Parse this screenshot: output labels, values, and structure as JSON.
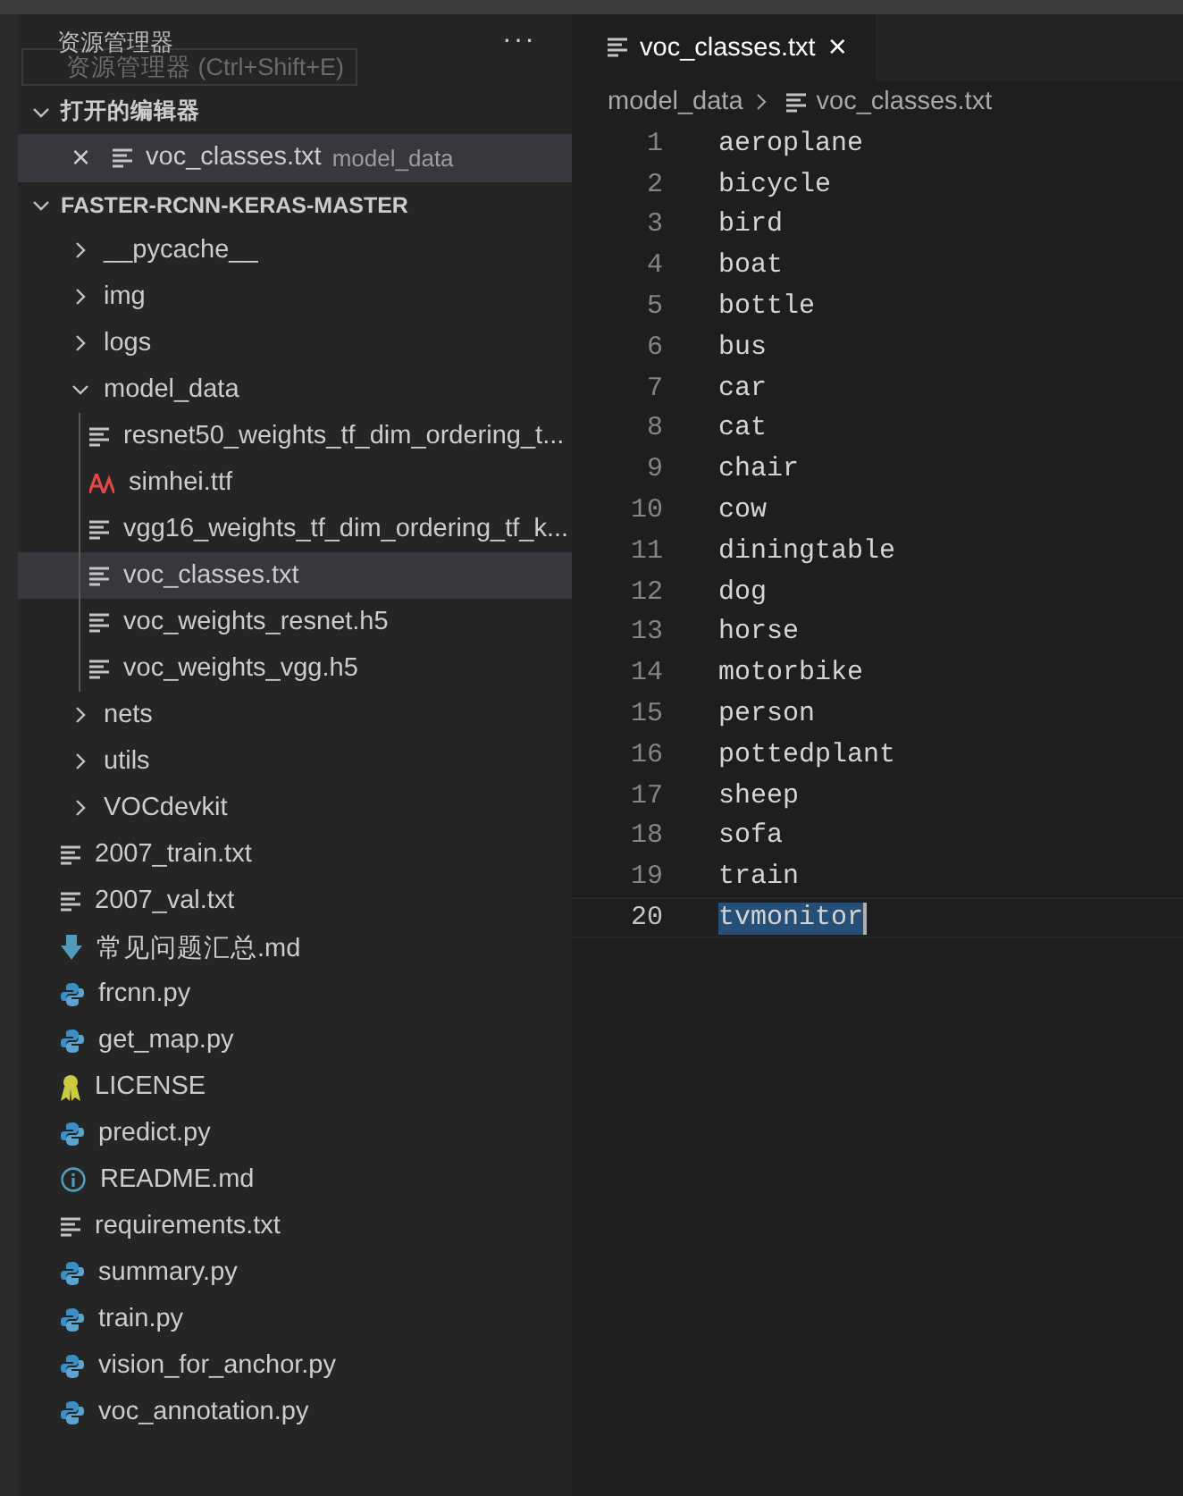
{
  "sidebar": {
    "title": "资源管理器",
    "more": "···",
    "tooltip": "资源管理器 (Ctrl+Shift+E)",
    "open_editors": {
      "title": "打开的编辑器",
      "expanded": true,
      "items": [
        {
          "close": "×",
          "name": "voc_classes.txt",
          "folder": "model_data",
          "kind": "text",
          "selected": true
        }
      ]
    },
    "project": {
      "title": "FASTER-RCNN-KERAS-MASTER",
      "expanded": true,
      "items": [
        {
          "name": "__pycache__",
          "kind": "folder",
          "expanded": false,
          "selected": false
        },
        {
          "name": "img",
          "kind": "folder",
          "expanded": false,
          "selected": false
        },
        {
          "name": "logs",
          "kind": "folder",
          "expanded": false,
          "selected": false
        },
        {
          "name": "model_data",
          "kind": "folder",
          "expanded": true,
          "selected": false,
          "children": [
            {
              "name": "resnet50_weights_tf_dim_ordering_t...",
              "kind": "text",
              "selected": false
            },
            {
              "name": "simhei.ttf",
              "kind": "font",
              "selected": false
            },
            {
              "name": "vgg16_weights_tf_dim_ordering_tf_k...",
              "kind": "text",
              "selected": false
            },
            {
              "name": "voc_classes.txt",
              "kind": "text",
              "selected": true
            },
            {
              "name": "voc_weights_resnet.h5",
              "kind": "text",
              "selected": false
            },
            {
              "name": "voc_weights_vgg.h5",
              "kind": "text",
              "selected": false
            }
          ]
        },
        {
          "name": "nets",
          "kind": "folder",
          "expanded": false,
          "selected": false
        },
        {
          "name": "utils",
          "kind": "folder",
          "expanded": false,
          "selected": false
        },
        {
          "name": "VOCdevkit",
          "kind": "folder",
          "expanded": false,
          "selected": false
        },
        {
          "name": "2007_train.txt",
          "kind": "text",
          "selected": false
        },
        {
          "name": "2007_val.txt",
          "kind": "text",
          "selected": false
        },
        {
          "name": "常见问题汇总.md",
          "kind": "download",
          "selected": false
        },
        {
          "name": "frcnn.py",
          "kind": "python",
          "selected": false
        },
        {
          "name": "get_map.py",
          "kind": "python",
          "selected": false
        },
        {
          "name": "LICENSE",
          "kind": "license",
          "selected": false
        },
        {
          "name": "predict.py",
          "kind": "python",
          "selected": false
        },
        {
          "name": "README.md",
          "kind": "info",
          "selected": false
        },
        {
          "name": "requirements.txt",
          "kind": "text",
          "selected": false
        },
        {
          "name": "summary.py",
          "kind": "python",
          "selected": false
        },
        {
          "name": "train.py",
          "kind": "python",
          "selected": false
        },
        {
          "name": "vision_for_anchor.py",
          "kind": "python",
          "selected": false
        },
        {
          "name": "voc_annotation.py",
          "kind": "python",
          "selected": false
        }
      ]
    }
  },
  "editor": {
    "tabs": [
      {
        "name": "voc_classes.txt",
        "close": "×",
        "selected": true
      }
    ],
    "breadcrumb": [
      "model_data",
      "voc_classes.txt"
    ],
    "lines": [
      {
        "number": "1",
        "text": "aeroplane",
        "current": false
      },
      {
        "number": "2",
        "text": "bicycle",
        "current": false
      },
      {
        "number": "3",
        "text": "bird",
        "current": false
      },
      {
        "number": "4",
        "text": "boat",
        "current": false
      },
      {
        "number": "5",
        "text": "bottle",
        "current": false
      },
      {
        "number": "6",
        "text": "bus",
        "current": false
      },
      {
        "number": "7",
        "text": "car",
        "current": false
      },
      {
        "number": "8",
        "text": "cat",
        "current": false
      },
      {
        "number": "9",
        "text": "chair",
        "current": false
      },
      {
        "number": "10",
        "text": "cow",
        "current": false
      },
      {
        "number": "11",
        "text": "diningtable",
        "current": false
      },
      {
        "number": "12",
        "text": "dog",
        "current": false
      },
      {
        "number": "13",
        "text": "horse",
        "current": false
      },
      {
        "number": "14",
        "text": "motorbike",
        "current": false
      },
      {
        "number": "15",
        "text": "person",
        "current": false
      },
      {
        "number": "16",
        "text": "pottedplant",
        "current": false
      },
      {
        "number": "17",
        "text": "sheep",
        "current": false
      },
      {
        "number": "18",
        "text": "sofa",
        "current": false
      },
      {
        "number": "19",
        "text": "train",
        "current": false
      },
      {
        "number": "20",
        "text": "tvmonitor",
        "current": true
      }
    ]
  }
}
